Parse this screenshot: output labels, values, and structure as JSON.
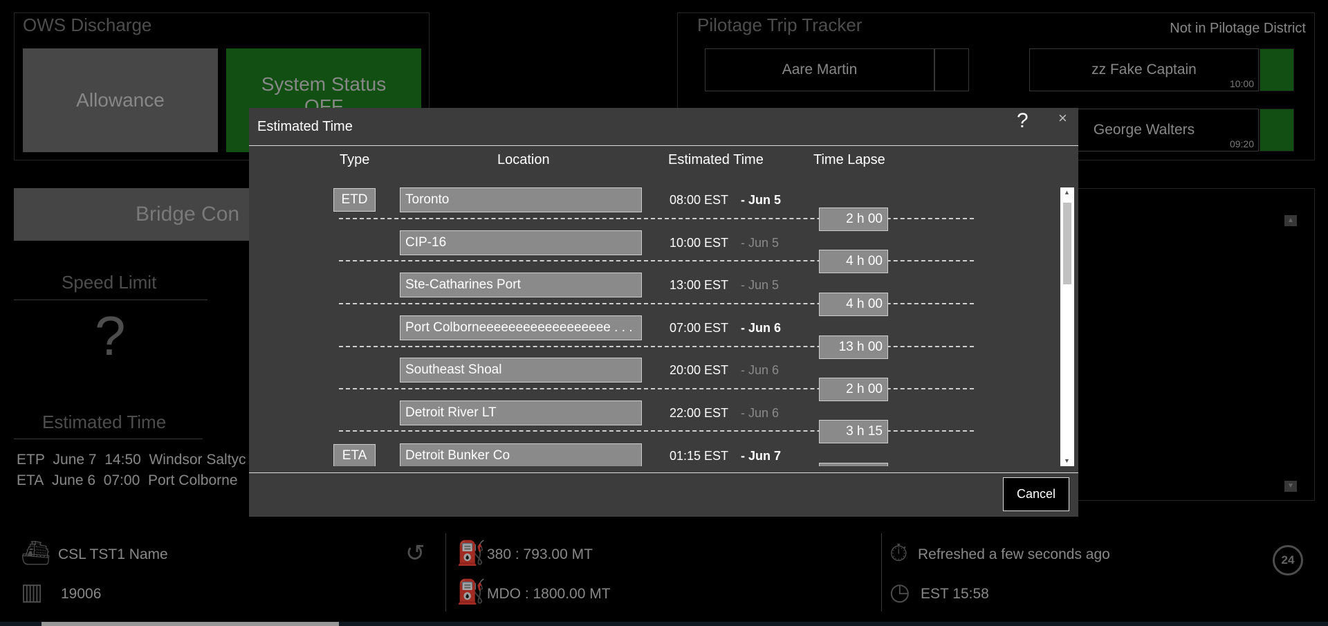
{
  "ows": {
    "title": "OWS Discharge",
    "allowance_label": "Allowance",
    "system_status_label": "System Status",
    "system_status_sub": "OFF"
  },
  "pilotage": {
    "title": "Pilotage Trip Tracker",
    "status": "Not in Pilotage District",
    "pilots": [
      {
        "name": "Aare Martin",
        "time": ""
      },
      {
        "name": "zz Fake Captain",
        "time": "10:00"
      },
      {
        "name": "George Walters",
        "time": "09:20"
      }
    ]
  },
  "bridge": {
    "label": "Bridge Con"
  },
  "speed": {
    "label": "Speed Limit",
    "value": "?"
  },
  "estimated_time": {
    "label": "Estimated Time",
    "lines": [
      {
        "kind": "ETP",
        "date": "June 7",
        "time": "14:50",
        "place": "Windsor Saltyc"
      },
      {
        "kind": "ETA",
        "date": "June 6",
        "time": "07:00",
        "place": "Port Colborne"
      }
    ]
  },
  "footer": {
    "vessel_name": "CSL TST1 Name",
    "vessel_id": "19006",
    "fuel_1": "380 :  793.00  MT",
    "fuel_2": "MDO :  1800.00  MT",
    "refreshed": "Refreshed a few seconds ago",
    "clock": "EST 15:58",
    "support_badge": "24"
  },
  "modal": {
    "title": "Estimated Time",
    "help": "?",
    "close": "×",
    "columns": {
      "type": "Type",
      "location": "Location",
      "estimated_time": "Estimated Time",
      "time_lapse": "Time Lapse"
    },
    "rows": [
      {
        "type": "ETD",
        "location": "Toronto",
        "time": "08:00 EST",
        "date": "- Jun 5",
        "date_style": "bold"
      },
      {
        "type": "",
        "location": "CIP-16",
        "time": "10:00 EST",
        "date": "- Jun 5",
        "date_style": "dim"
      },
      {
        "type": "",
        "location": "Ste-Catharines Port",
        "time": "13:00 EST",
        "date": "- Jun 5",
        "date_style": "dim"
      },
      {
        "type": "",
        "location": "Port Colborneeeeeeeeeeeeeeeeee . . .",
        "time": "07:00 EST",
        "date": "- Jun 6",
        "date_style": "bold"
      },
      {
        "type": "",
        "location": "Southeast Shoal",
        "time": "20:00 EST",
        "date": "- Jun 6",
        "date_style": "dim"
      },
      {
        "type": "",
        "location": "Detroit River LT",
        "time": "22:00 EST",
        "date": "- Jun 6",
        "date_style": "dim"
      },
      {
        "type": "ETA",
        "location": "Detroit Bunker Co",
        "time": "01:15 EST",
        "date": "- Jun 7",
        "date_style": "bold"
      }
    ],
    "lapses": [
      "2 h 00",
      "4 h 00",
      "4 h 00",
      "13 h 00",
      "2 h 00",
      "3 h 15",
      ""
    ],
    "cancel_label": "Cancel"
  }
}
